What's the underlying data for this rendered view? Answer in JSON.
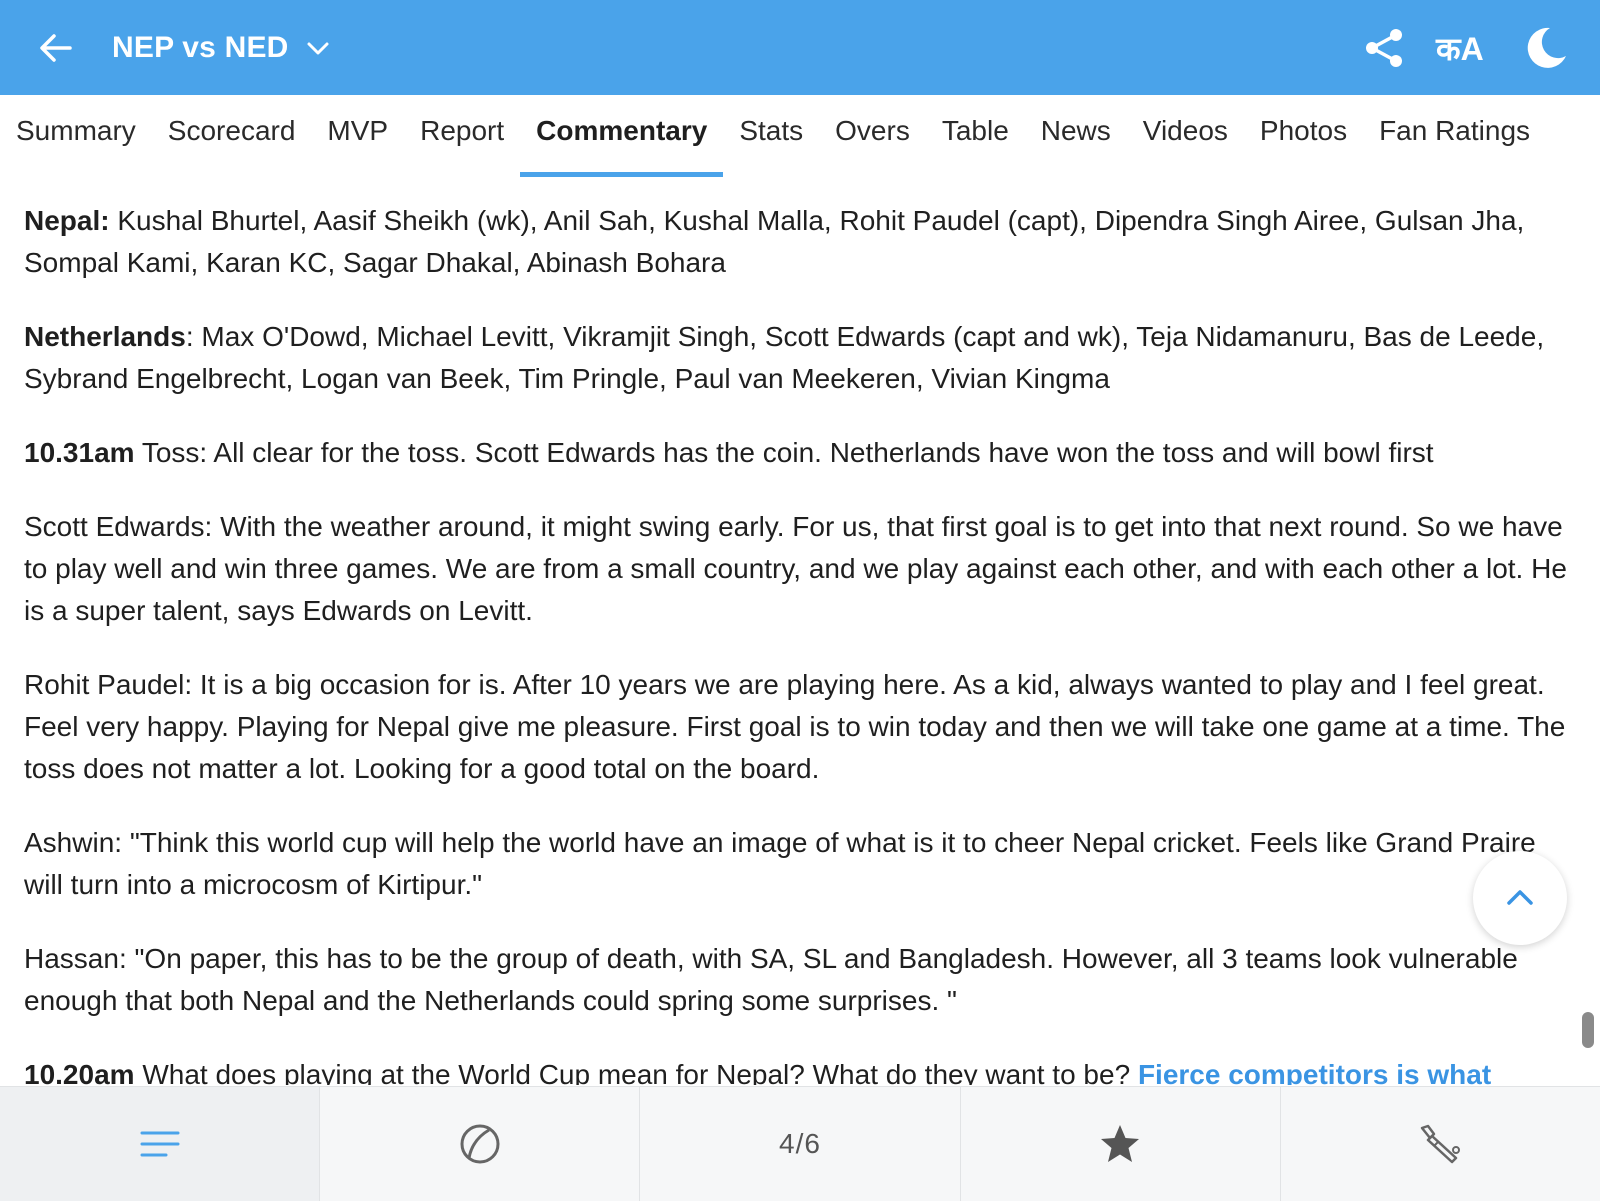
{
  "header": {
    "title": "NEP vs NED",
    "lang_label": "कA",
    "colors": {
      "bar": "#4aa3ea",
      "accent": "#3a94e3"
    },
    "icons": [
      "back-arrow-icon",
      "chevron-down-icon",
      "share-icon",
      "moon-icon"
    ]
  },
  "tabs": [
    {
      "label": "Summary"
    },
    {
      "label": "Scorecard"
    },
    {
      "label": "MVP"
    },
    {
      "label": "Report"
    },
    {
      "label": "Commentary",
      "active": true
    },
    {
      "label": "Stats"
    },
    {
      "label": "Overs"
    },
    {
      "label": "Table"
    },
    {
      "label": "News"
    },
    {
      "label": "Videos"
    },
    {
      "label": "Photos"
    },
    {
      "label": "Fan Ratings"
    }
  ],
  "commentary": {
    "nepal_lead": "Nepal:",
    "nepal_text": " Kushal Bhurtel, Aasif Sheikh (wk), Anil Sah, Kushal Malla, Rohit Paudel (capt), Dipendra Singh Airee, Gulsan Jha, Sompal Kami, Karan KC, Sagar Dhakal, Abinash Bohara",
    "ned_lead": "Netherlands",
    "ned_text": ": Max O'Dowd, Michael Levitt, Vikramjit Singh, Scott Edwards (capt and wk), Teja Nidamanuru, Bas de Leede, Sybrand Engelbrecht, Logan van Beek, Tim Pringle, Paul van Meekeren, Vivian Kingma",
    "toss_time": "10.31am",
    "toss_text": " Toss: All clear for the toss. Scott Edwards has the coin. Netherlands have won the toss and will bowl first",
    "edwards": "Scott Edwards: With the weather around, it might swing early. For us, that first goal is to get into that next round. So we have to play well and win three games. We are from a small country, and we play against each other, and with each other a lot. He is a super talent, says Edwards on Levitt.",
    "paudel": "Rohit Paudel: It is a big occasion for is. After 10 years we are playing here. As a kid, always wanted to play and I feel great. Feel very happy. Playing for Nepal give me pleasure. First goal is to win today and then we will take one game at a time. The toss does not matter a lot. Looking for a good total on the board.",
    "ashwin": "Ashwin: \"Think this world cup will help the world have an image of what is it to cheer Nepal cricket. Feels like Grand Praire will turn into a microcosm of Kirtipur.\"",
    "hassan": "Hassan: \"On paper, this has to be the group of death, with SA, SL and Bangladesh. However, all 3 teams look vulnerable enough that both Nepal and the Netherlands could spring some surprises. \"",
    "next_time": "10.20am",
    "next_text": " What does playing at the World Cup mean for Nepal? What do they want to be? ",
    "next_link": "Fierce competitors is what"
  },
  "bottom_nav": {
    "page_indicator": "4/6",
    "icons": [
      "menu-icon",
      "ball-icon",
      "star-icon",
      "bat-icon"
    ]
  }
}
